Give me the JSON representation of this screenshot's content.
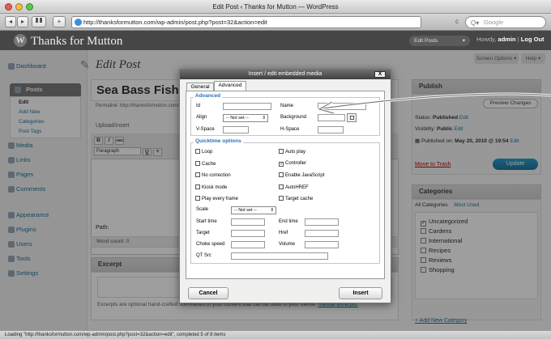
{
  "browser": {
    "window_title": "Edit Post ‹ Thanks for Mutton — WordPress",
    "url": "http://thanksformutton.com/wp-admin/post.php?post=32&action=edit",
    "search_placeholder": "Google",
    "nav_back": "◂",
    "nav_forward": "▸",
    "add_bookmark": "+",
    "reload": "c",
    "status": "Loading \"http://thanksformutton.com/wp-admin/post.php?post=32&action=edit\", completed 5 of 8 items"
  },
  "wp_header": {
    "site_title": "Thanks for Mutton",
    "logo_glyph": "W",
    "favorites": "Edit Posts",
    "howdy": "Howdy,",
    "user": "admin",
    "separator": "|",
    "logout": "Log Out"
  },
  "sidebar": {
    "items": [
      {
        "label": "Dashboard"
      },
      {
        "label": "Posts"
      },
      {
        "label": "Media"
      },
      {
        "label": "Links"
      },
      {
        "label": "Pages"
      },
      {
        "label": "Comments"
      },
      {
        "label": "Appearance"
      },
      {
        "label": "Plugins"
      },
      {
        "label": "Users"
      },
      {
        "label": "Tools"
      },
      {
        "label": "Settings"
      }
    ],
    "posts_sub": [
      "Edit",
      "Add New",
      "Categories",
      "Post Tags"
    ]
  },
  "main": {
    "page_title": "Edit Post",
    "screen_options": "Screen Options ▾",
    "help": "Help ▾",
    "post_title": "Sea Bass Fish and",
    "permalink": "Permalink: http://thanksformutton.com/",
    "upload_insert": "Upload/Insert",
    "format_select": "Paragraph",
    "editor_buttons": [
      "B",
      "I",
      "ABC",
      "U",
      "≡"
    ],
    "path_label": "Path:",
    "word_count": "Word count: 0",
    "excerpt_title": "Excerpt",
    "excerpt_help": "Excerpts are optional hand-crafted summaries of your content that can be used in your theme.",
    "excerpt_link": "manual excerpts."
  },
  "publish_box": {
    "title": "Publish",
    "preview": "Preview Changes",
    "status_label": "Status:",
    "status_value": "Published",
    "visibility_label": "Visibility:",
    "visibility_value": "Public",
    "published_on_label": "Published on:",
    "published_on_value": "May 20, 2010 @ 19:54",
    "edit": "Edit",
    "move_to_trash": "Move to Trash",
    "update": "Update"
  },
  "categories_box": {
    "title": "Categories",
    "tabs": [
      "All Categories",
      "Most Used"
    ],
    "items": [
      {
        "label": "Uncategorized",
        "checked": true
      },
      {
        "label": "Cardens",
        "checked": false
      },
      {
        "label": "International",
        "checked": false
      },
      {
        "label": "Recipes",
        "checked": false
      },
      {
        "label": "Reviews",
        "checked": false
      },
      {
        "label": "Shopping",
        "checked": false
      }
    ],
    "add_new": "+ Add New Category"
  },
  "dialog": {
    "title": "Insert / edit embedded media",
    "close": "X",
    "tabs": [
      "General",
      "Advanced"
    ],
    "advanced_legend": "Advanced",
    "labels": {
      "id": "Id",
      "name": "Name",
      "align": "Align",
      "background": "Background",
      "vspace": "V-Space",
      "hspace": "H-Space"
    },
    "align_value": "-- Not set --",
    "quicktime_legend": "Quicktime options",
    "checkboxes": [
      {
        "label": "Loop",
        "checked": false
      },
      {
        "label": "Auto play",
        "checked": false
      },
      {
        "label": "Cache",
        "checked": false
      },
      {
        "label": "Controller",
        "checked": true
      },
      {
        "label": "No correction",
        "checked": false
      },
      {
        "label": "Enable JavaScript",
        "checked": false
      },
      {
        "label": "Kiosk mode",
        "checked": false
      },
      {
        "label": "AutoHREF",
        "checked": false
      },
      {
        "label": "Play every frame",
        "checked": false
      },
      {
        "label": "Target cache",
        "checked": false
      }
    ],
    "scale_label": "Scale",
    "scale_value": "-- Not set --",
    "fields": {
      "start_time": "Start time",
      "end_time": "End time",
      "target": "Target",
      "href": "Href",
      "choke_speed": "Choke speed",
      "volume": "Volume",
      "qt_src": "QT Src"
    },
    "cancel": "Cancel",
    "insert": "Insert"
  }
}
